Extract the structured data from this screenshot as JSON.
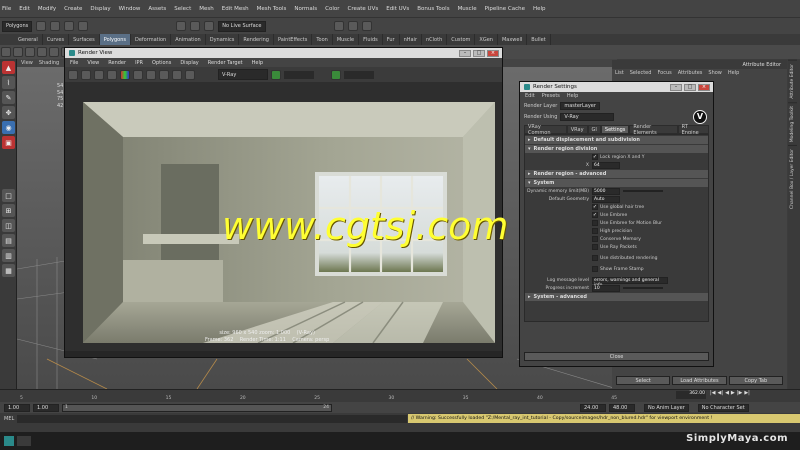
{
  "menubar": {
    "items": [
      "File",
      "Edit",
      "Modify",
      "Create",
      "Display",
      "Window",
      "Assets",
      "Select",
      "Mesh",
      "Edit Mesh",
      "Mesh Tools",
      "Normals",
      "Color",
      "Create UVs",
      "Edit UVs",
      "Bonus Tools",
      "Muscle",
      "Pipeline Cache",
      "Help"
    ]
  },
  "statusline": {
    "mode": "Polygons",
    "live_surface": "No Live Surface"
  },
  "shelf": {
    "tabs": [
      "General",
      "Curves",
      "Surfaces",
      "Polygons",
      "Deformation",
      "Animation",
      "Dynamics",
      "Rendering",
      "PaintEffects",
      "Toon",
      "Muscle",
      "Fluids",
      "Fur",
      "nHair",
      "nCloth",
      "Custom",
      "XGen",
      "Maxwell",
      "Bullet"
    ],
    "active": "Polygons"
  },
  "viewport": {
    "menu": [
      "View",
      "Shading",
      "Li"
    ],
    "stats": [
      "54",
      "54",
      "75",
      "42"
    ]
  },
  "render_view": {
    "title": "Render View",
    "menu": [
      "File",
      "View",
      "Render",
      "IPR",
      "Options",
      "Display",
      "Render Target",
      "Help"
    ],
    "renderer": "V-Ray",
    "info": {
      "size": "size: 960 x 540  zoom: 1.000",
      "renderer_tag": "(V-Ray)",
      "frame": "Frame: 362",
      "render_time": "Render Time: 1:11",
      "camera": "Camera: persp"
    }
  },
  "render_settings": {
    "title": "Render Settings",
    "menu": [
      "Edit",
      "Presets",
      "Help"
    ],
    "render_layer_label": "Render Layer",
    "render_layer": "masterLayer",
    "render_using_label": "Render Using",
    "render_using": "V-Ray",
    "tabs": [
      "VRay Common",
      "VRay",
      "GI",
      "Settings",
      "Render Elements",
      "RT Engine"
    ],
    "active_tab": "Settings",
    "sections": {
      "displacement": "Default displacement and subdivision",
      "region": "Render region division",
      "region_adv": "Render region - advanced",
      "system": "System",
      "system_adv": "System - advanced"
    },
    "region": {
      "lock_label": "Lock region X and Y",
      "x_label": "X",
      "x_value": "64"
    },
    "system": {
      "mem_label": "Dynamic memory limit(MB)",
      "mem_value": "5000",
      "geom_label": "Default Geometry",
      "geom_value": "Auto",
      "global_hair": "Use global hair tree",
      "embree": "Use Embree",
      "embree_blur": "Use Embree for Motion Blur",
      "high_precision": "High precision",
      "conserve": "Conserve Memory",
      "ray_packets": "Use Ray Packets",
      "distributed": "Use distributed rendering",
      "frame_stamp": "Show Frame Stamp",
      "log_label": "Log message level",
      "log_value": "errors, warnings and general info",
      "progress_label": "Progress increment",
      "progress_value": "10"
    },
    "close_label": "Close"
  },
  "attribute_editor": {
    "title": "Attribute Editor",
    "menu": [
      "List",
      "Selected",
      "Focus",
      "Attributes",
      "Show",
      "Help"
    ],
    "buttons": [
      "Select",
      "Load Attributes",
      "Copy Tab"
    ]
  },
  "side_tabs": [
    "Attribute Editor",
    "Modeling Toolkit",
    "Channel Box / Layer Editor"
  ],
  "timeline": {
    "ticks": [
      "5",
      "10",
      "15",
      "20",
      "25",
      "30",
      "35",
      "40",
      "45"
    ],
    "current_frame": "362.00",
    "play_start": "24.00",
    "play_end": "48.00"
  },
  "range": {
    "start": "1.00",
    "current": "1.00",
    "slider_start": "1",
    "slider_end": "24",
    "anim_layer": "No Anim Layer",
    "char_set": "No Character Set"
  },
  "command": {
    "label": "MEL",
    "warning": "// Warning: Successfully loaded \"Z:/Mental_ray_int_tutorial - Copy/sourceimages/hdr_non_blured.hdr\" for viewport environment !"
  },
  "brand": "SimplyMaya.com",
  "watermark": "www.cgtsj.com",
  "colors": {
    "ui_bg": "#3c3c3c",
    "active_tab": "#5a6f86",
    "warning_bar": "#d8c870",
    "watermark": "#ffff33"
  }
}
